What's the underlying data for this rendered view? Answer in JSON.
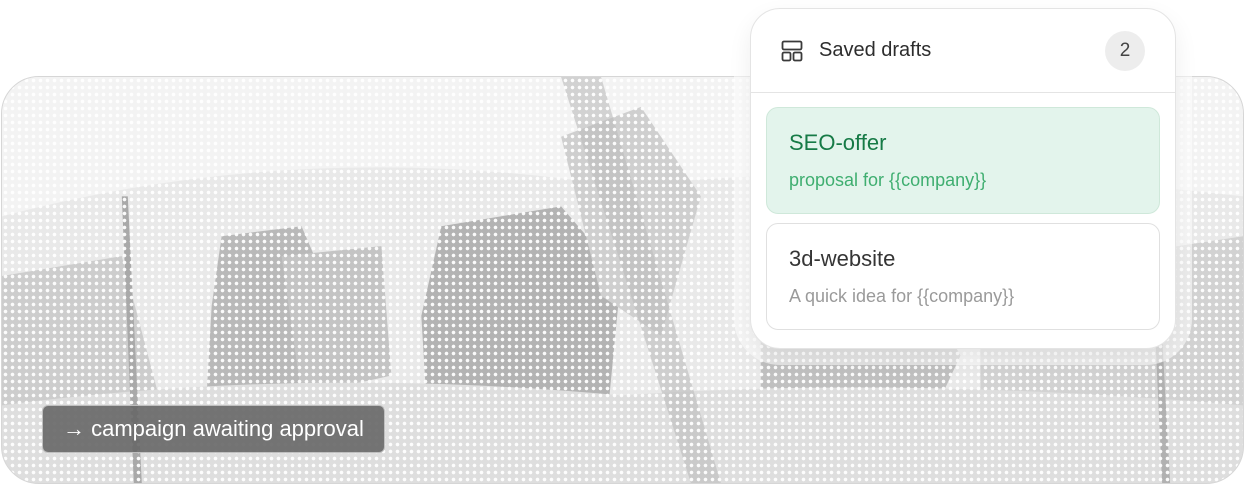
{
  "status": {
    "label": "→ campaign awaiting approval"
  },
  "drafts_panel": {
    "icon": "layout-icon",
    "title": "Saved drafts",
    "count": "2",
    "items": [
      {
        "name": "SEO-offer",
        "subtitle": "proposal for {{company}}",
        "selected": true
      },
      {
        "name": "3d-website",
        "subtitle": "A quick idea for {{company}}",
        "selected": false
      }
    ]
  },
  "colors": {
    "accent_green": "#167a46",
    "selected_bg": "#e3f4ec"
  }
}
